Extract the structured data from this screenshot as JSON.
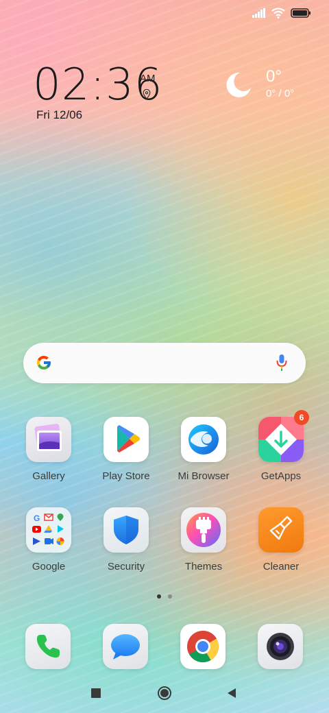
{
  "status": {
    "icons": [
      "signal-icon",
      "wifi-icon",
      "battery-icon"
    ]
  },
  "clock": {
    "time": "02:36",
    "ampm": "AM",
    "date": "Fri 12/06"
  },
  "weather": {
    "icon": "moon-icon",
    "temp": "0°",
    "range": "0° / 0°"
  },
  "search": {
    "logo": "google-g-icon",
    "mic": "microphone-icon"
  },
  "apps": [
    {
      "label": "Gallery",
      "icon": "gallery-icon"
    },
    {
      "label": "Play Store",
      "icon": "play-store-icon"
    },
    {
      "label": "Mi Browser",
      "icon": "mi-browser-icon"
    },
    {
      "label": "GetApps",
      "icon": "getapps-icon",
      "badge": "6"
    },
    {
      "label": "Google",
      "icon": "google-folder-icon"
    },
    {
      "label": "Security",
      "icon": "security-shield-icon"
    },
    {
      "label": "Themes",
      "icon": "themes-brush-icon"
    },
    {
      "label": "Cleaner",
      "icon": "cleaner-broom-icon"
    }
  ],
  "page_indicator": {
    "count": 2,
    "active": 1
  },
  "dock": [
    "phone-icon",
    "messages-icon",
    "chrome-icon",
    "camera-icon"
  ],
  "nav": [
    "recents-square-icon",
    "home-circle-icon",
    "back-triangle-icon"
  ]
}
